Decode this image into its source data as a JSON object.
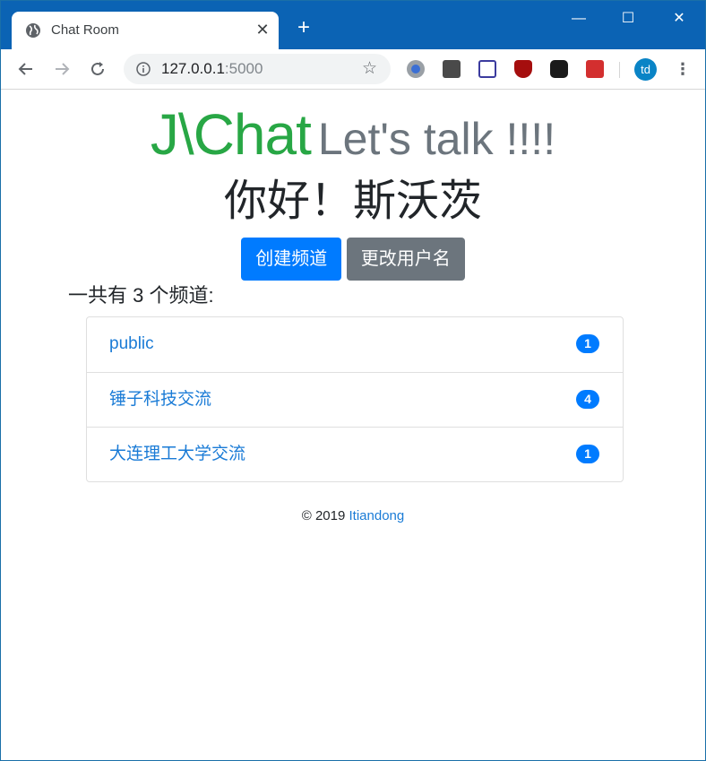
{
  "browser": {
    "tab_title": "Chat Room",
    "close_label": "✕",
    "new_tab_label": "+",
    "url_host": "127.0.0.1",
    "url_port": ":5000",
    "profile_initials": "td",
    "window_controls": {
      "minimize": "—",
      "maximize": "☐",
      "close": "✕"
    }
  },
  "header": {
    "logo": "J\\Chat",
    "tagline": "Let's talk !!!!",
    "greeting": "你好！斯沃茨"
  },
  "actions": {
    "create_channel": "创建频道",
    "change_username": "更改用户名"
  },
  "channels": {
    "summary": "一共有 3 个频道:",
    "items": [
      {
        "name": "public",
        "count": "1"
      },
      {
        "name": "锤子科技交流",
        "count": "4"
      },
      {
        "name": "大连理工大学交流",
        "count": "1"
      }
    ]
  },
  "footer": {
    "copyright": "© 2019",
    "author": "Itiandong"
  },
  "colors": {
    "brand_green": "#28a745",
    "primary": "#007bff",
    "secondary": "#6c757d",
    "titlebar": "#0b63b4"
  }
}
